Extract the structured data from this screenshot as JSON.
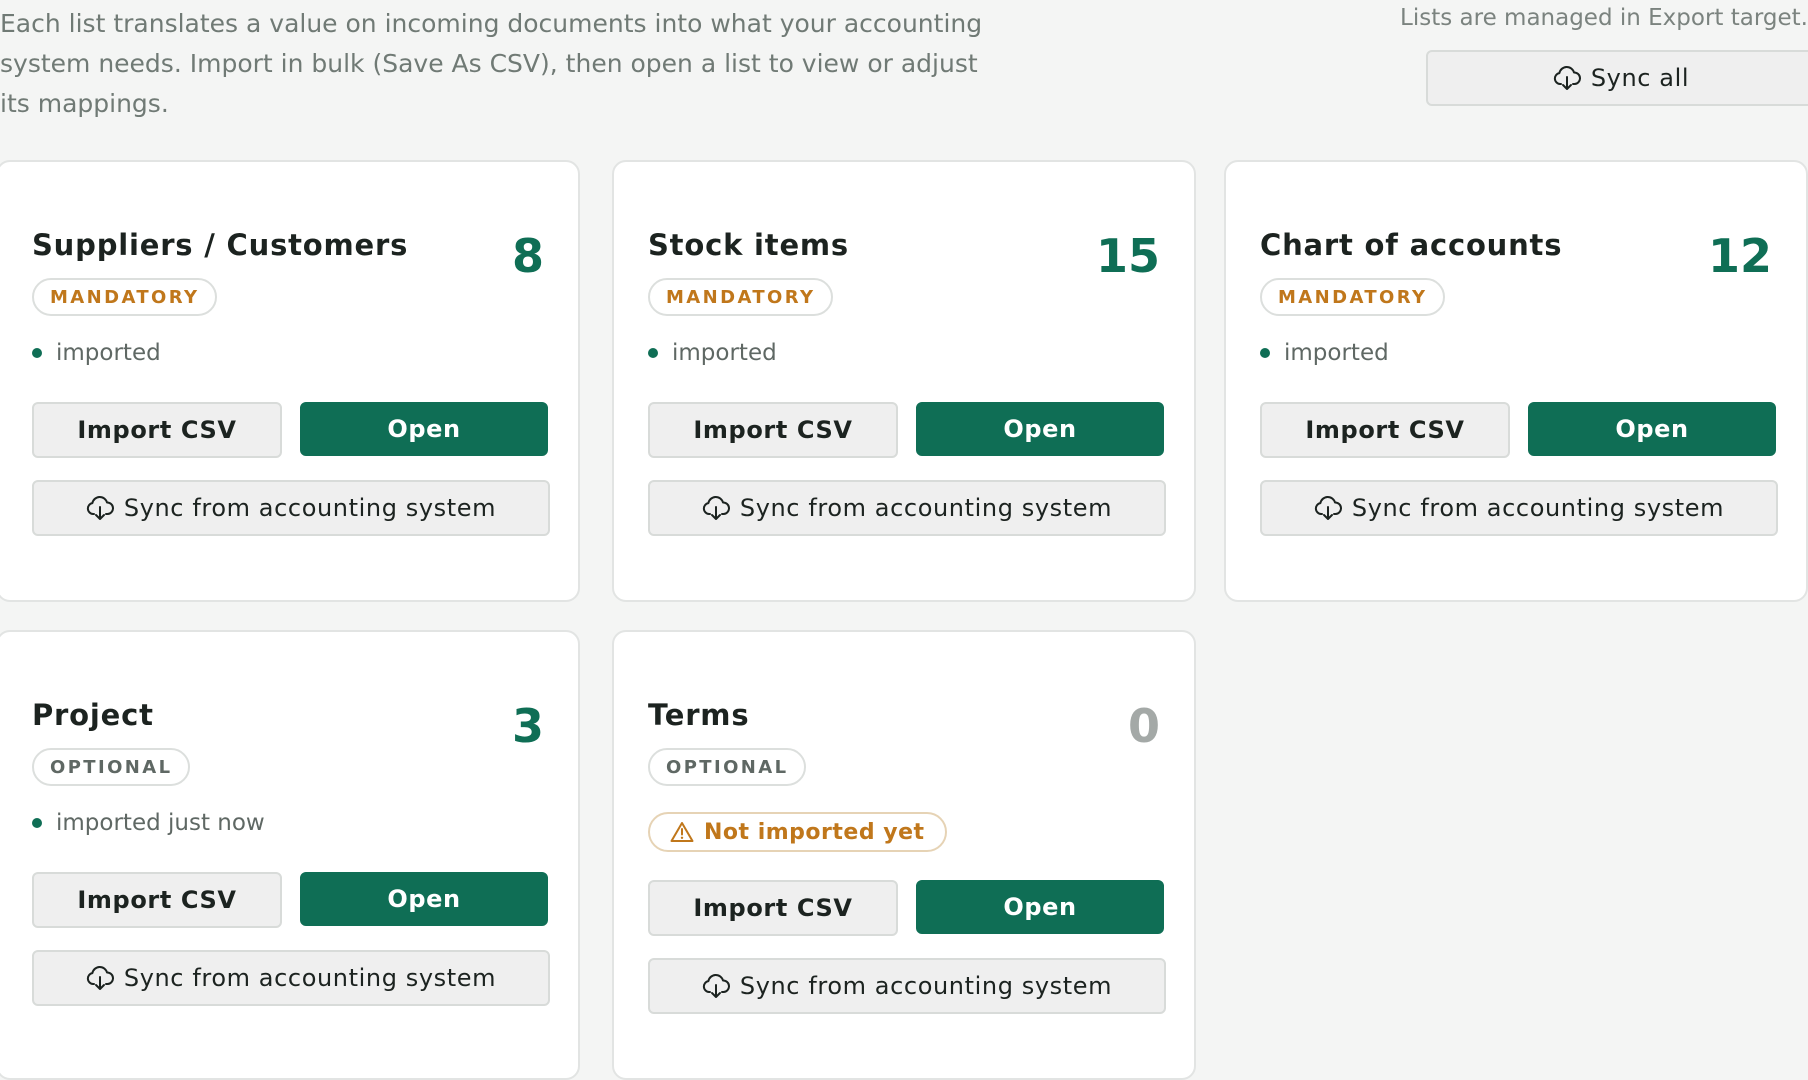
{
  "intro_text": "Each list translates a value on incoming documents into what your accounting system needs. Import in bulk (Save As CSV), then open a list to view or adjust its mappings.",
  "managed_note": "Lists are managed in Export target.",
  "sync_all_label": "Sync all",
  "buttons": {
    "import": "Import CSV",
    "open": "Open",
    "sync": "Sync from accounting system"
  },
  "icons": {
    "sync": "cloud-download-icon",
    "warning": "warning-triangle-icon"
  },
  "colors": {
    "primary": "#0f6e55",
    "mandatory": "#c0771b",
    "muted": "#a4a9a7"
  },
  "lists": [
    {
      "title": "Suppliers / Customers",
      "count": "8",
      "requirement": "MANDATORY",
      "status": "imported"
    },
    {
      "title": "Stock items",
      "count": "15",
      "requirement": "MANDATORY",
      "status": "imported"
    },
    {
      "title": "Chart of accounts",
      "count": "12",
      "requirement": "MANDATORY",
      "status": "imported"
    },
    {
      "title": "Project",
      "count": "3",
      "requirement": "OPTIONAL",
      "status": "imported just now"
    },
    {
      "title": "Terms",
      "count": "0",
      "requirement": "OPTIONAL",
      "status": "Not imported yet"
    }
  ]
}
